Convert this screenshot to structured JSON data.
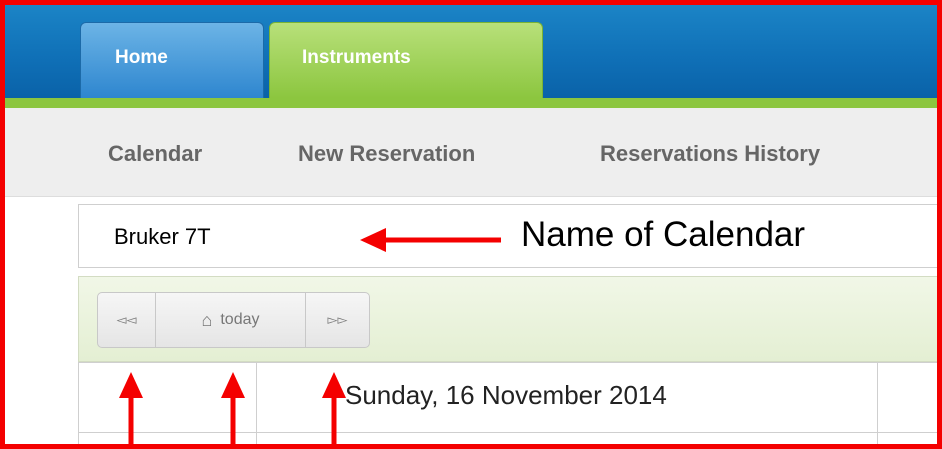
{
  "tabs": [
    {
      "label": "Home"
    },
    {
      "label": "Instruments"
    }
  ],
  "subnav": [
    {
      "label": "Calendar"
    },
    {
      "label": "New Reservation"
    },
    {
      "label": "Reservations History"
    }
  ],
  "calendar_name": "Bruker 7T",
  "annotation": "Name of Calendar",
  "toolbar": {
    "prev": "◅◅",
    "today": "today",
    "next": "▻▻"
  },
  "day_header": "Sunday, 16 November 2014",
  "colors": {
    "annotation_red": "#f40000",
    "topbar_blue": "#0f6fb6",
    "accent_green": "#8cc63f"
  }
}
